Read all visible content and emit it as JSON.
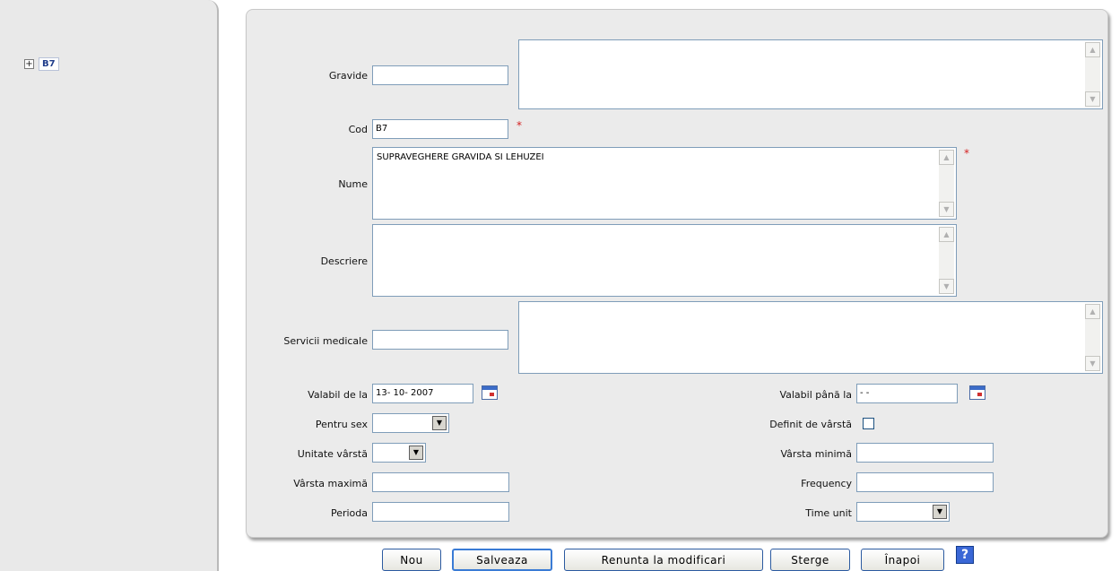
{
  "tree": {
    "expander": "+",
    "node_label": "B7"
  },
  "form": {
    "gravide": {
      "label": "Gravide",
      "value": ""
    },
    "cod": {
      "label": "Cod",
      "value": "B7",
      "required_mark": "*"
    },
    "nume": {
      "label": "Nume",
      "value": "SUPRAVEGHERE GRAVIDA SI LEHUZEI",
      "required_mark": "*"
    },
    "descriere": {
      "label": "Descriere",
      "value": ""
    },
    "servicii": {
      "label": "Servicii medicale",
      "value": ""
    },
    "valabil_de_la": {
      "label": "Valabil de la",
      "value": "13- 10-  2007"
    },
    "valabil_pana_la": {
      "label": "Valabil până la",
      "value": "  -   -"
    },
    "pentru_sex": {
      "label": "Pentru sex",
      "value": ""
    },
    "definit_de_varsta": {
      "label": "Definit de vârstă",
      "checked": false
    },
    "unitate_varsta": {
      "label": "Unitate vârstă",
      "value": ""
    },
    "varsta_minima": {
      "label": "Vârsta minimă",
      "value": ""
    },
    "varsta_maxima": {
      "label": "Vârsta maximă",
      "value": ""
    },
    "frequency": {
      "label": "Frequency",
      "value": ""
    },
    "perioada": {
      "label": "Perioda",
      "value": ""
    },
    "time_unit": {
      "label": "Time unit",
      "value": ""
    }
  },
  "buttons": {
    "nou": "Nou",
    "salveaza": "Salveaza",
    "renunta": "Renunta la modificari",
    "sterge": "Sterge",
    "inapoi": "Înapoi",
    "help": "?"
  },
  "icons": {
    "scroll_up": "scroll-up-arrow-icon",
    "scroll_down": "scroll-down-arrow-icon",
    "calendar": "calendar-icon",
    "dropdown": "chevron-down-icon",
    "help": "help-icon"
  },
  "colors": {
    "required": "#d42020",
    "panel_bg": "#ebebeb",
    "input_border": "#7f9db9",
    "button_border": "#2b5aa0"
  }
}
